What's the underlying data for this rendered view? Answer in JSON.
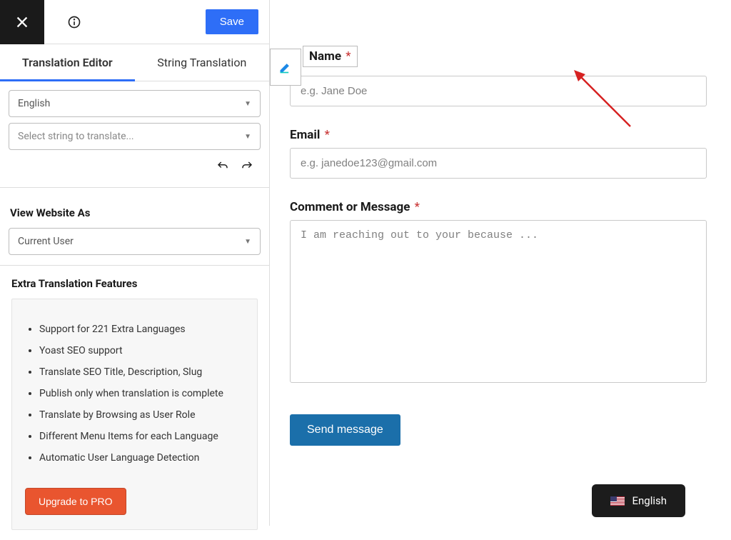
{
  "topbar": {
    "save": "Save"
  },
  "tabs": {
    "editor": "Translation Editor",
    "string": "String Translation"
  },
  "selects": {
    "language": "English",
    "string_placeholder": "Select string to translate..."
  },
  "view": {
    "title": "View Website As",
    "current": "Current User"
  },
  "features": {
    "title": "Extra Translation Features",
    "items": [
      "Support for 221 Extra Languages",
      "Yoast SEO support",
      "Translate SEO Title, Description, Slug",
      "Publish only when translation is complete",
      "Translate by Browsing as User Role",
      "Different Menu Items for each Language",
      "Automatic User Language Detection"
    ],
    "upgrade": "Upgrade to PRO"
  },
  "form": {
    "name_label": "Name",
    "name_placeholder": "e.g. Jane Doe",
    "email_label": "Email",
    "email_placeholder": "e.g. janedoe123@gmail.com",
    "comment_label": "Comment or Message",
    "comment_placeholder": "I am reaching out to your because ...",
    "submit": "Send message"
  },
  "lang_switch": "English"
}
